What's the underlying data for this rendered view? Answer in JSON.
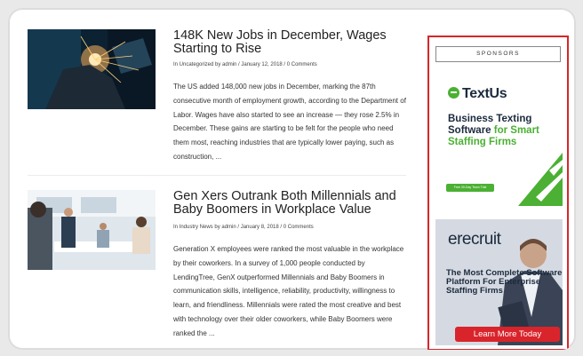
{
  "articles": [
    {
      "title": "148K New Jobs in December, Wages Starting to Rise",
      "meta": "In Uncategorized by admin / January 12, 2018 / 0 Comments",
      "excerpt": "The US added 148,000 new jobs in December, marking the 87th consecutive month of employment growth, according to the Department of Labor. Wages have also started to see an increase — they rose 2.5% in December. These gains are starting to be felt for the people who need them most, reaching industries that are typically lower paying, such as construction, ..."
    },
    {
      "title": "Gen Xers Outrank Both Millennials and Baby Boomers in Workplace Value",
      "meta": "In Industry News by admin / January 8, 2018 / 0 Comments",
      "excerpt": "Generation X employees were ranked the most valuable in the workplace by their coworkers. In a survey of 1,000 people conducted by LendingTree, GenX outperformed Millennials and Baby Boomers in communication skills, intelligence, reliability, productivity, willingness to learn, and friendliness. Millennials were rated the most creative and best with technology over their older coworkers, while Baby Boomers were ranked the ..."
    }
  ],
  "sidebar": {
    "heading": "SPONSORS",
    "ad1": {
      "brand": "TextUs",
      "line1": "Business Texting",
      "line2": "Software ",
      "line2_highlight": "for Smart",
      "line3": "Staffing Firms",
      "button": "Free 30-Day Team Trial"
    },
    "ad2": {
      "brand": "erecruit",
      "text": "The Most Complete Software Platform For Enterprise Staffing Firms",
      "button": "Learn More Today"
    }
  },
  "colors": {
    "accent_red": "#d8262a",
    "textus_green": "#4bb033",
    "navy": "#1b2a3d"
  }
}
